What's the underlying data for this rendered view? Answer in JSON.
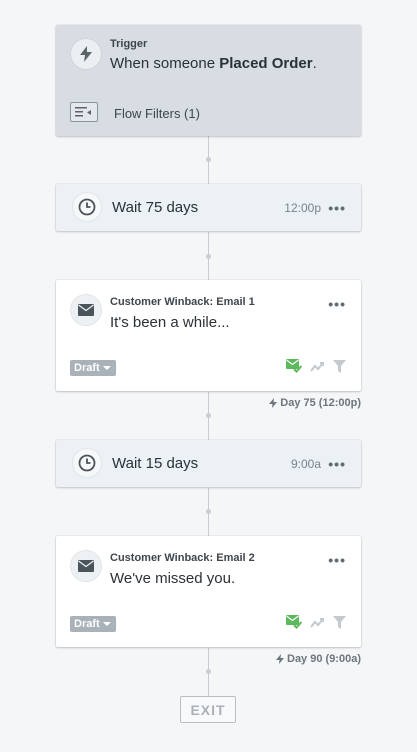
{
  "trigger": {
    "label": "Trigger",
    "text_prefix": "When someone ",
    "text_bold": "Placed Order",
    "text_suffix": ".",
    "filters_label": "Flow Filters (1)"
  },
  "steps": [
    {
      "type": "wait",
      "label": "Wait 75 days",
      "time": "12:00p",
      "menu": "•••"
    },
    {
      "type": "email",
      "name": "Customer Winback: Email 1",
      "subject": "It's been a while...",
      "status": "Draft",
      "menu": "•••",
      "day_label": "Day 75 (12:00p)"
    },
    {
      "type": "wait",
      "label": "Wait 15 days",
      "time": "9:00a",
      "menu": "•••"
    },
    {
      "type": "email",
      "name": "Customer Winback: Email 2",
      "subject": "We've missed you.",
      "status": "Draft",
      "menu": "•••",
      "day_label": "Day 90 (9:00a)"
    }
  ],
  "exit_label": "EXIT",
  "colors": {
    "background": "#f4f6f7",
    "trigger_bg": "#d8dde3",
    "wait_bg": "#ebf1f4",
    "email_bg": "#ffffff",
    "draft_badge": "#a9b2b8",
    "sent_green": "#5cb85c",
    "connector": "#c6ced3"
  },
  "icons": {
    "trigger": "lightning-icon",
    "filters": "filter-panel-icon",
    "wait": "clock-icon",
    "email": "envelope-icon",
    "smart_sending": "email-check-icon",
    "stats": "trend-icon",
    "filter": "funnel-icon"
  }
}
